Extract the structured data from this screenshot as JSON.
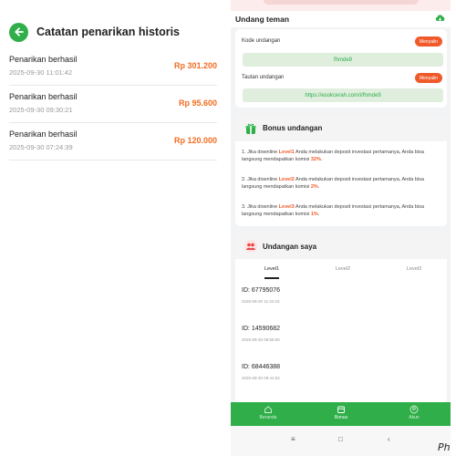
{
  "history": {
    "title": "Catatan penarikan historis",
    "rows": [
      {
        "status": "Penarikan berhasil",
        "time": "2025-09-30 11:01:42",
        "amount": "Rp 301.200"
      },
      {
        "status": "Penarikan berhasil",
        "time": "2025-09-30 09:30:21",
        "amount": "Rp 95.600"
      },
      {
        "status": "Penarikan berhasil",
        "time": "2025-09-30 07:24:39",
        "amount": "Rp 120.000"
      }
    ]
  },
  "invite": {
    "title": "Undang teman",
    "code_label": "Kode undangan",
    "code_value": "fhmde9",
    "link_label": "Tautan undangan",
    "link_value": "https://esokcerah.com/i/fhmde9",
    "copy_label": "Menyalin"
  },
  "bonus": {
    "title": "Bonus undangan",
    "items": [
      {
        "prefix": "1. Jika downline ",
        "level": "Level1",
        "mid": " Anda melakukan deposit investasi pertamanya, Anda bisa langsung mendapatkan komisi ",
        "pct": "32%",
        "suffix": "."
      },
      {
        "prefix": "2. Jika downline ",
        "level": "Level2",
        "mid": " Anda melakukan deposit investasi pertamanya, Anda bisa langsung mendapatkan komisi ",
        "pct": "2%",
        "suffix": "."
      },
      {
        "prefix": "3. Jika downline ",
        "level": "Level3",
        "mid": " Anda melakukan deposit investasi pertamanya, Anda bisa langsung mendapatkan komisi ",
        "pct": "1%",
        "suffix": "."
      }
    ]
  },
  "myinvites": {
    "title": "Undangan saya",
    "tabs": [
      "Level1",
      "Level2",
      "Level3"
    ],
    "items": [
      {
        "id": "ID: 67795076",
        "time": "2025-09-30 11:34:16"
      },
      {
        "id": "ID: 14590682",
        "time": "2025-09-30 09:58:56"
      },
      {
        "id": "ID: 68446388",
        "time": "2025-09-30 09:41:02"
      }
    ]
  },
  "nav": {
    "items": [
      "Beranda",
      "Bonus",
      "Akun"
    ]
  },
  "system_nav": {
    "menu": "≡",
    "home": "□",
    "back": "‹"
  },
  "corner_text": "Ph",
  "colors": {
    "green": "#2fae4a",
    "orange": "#f26d21",
    "copy_button": "#f05a2a"
  }
}
